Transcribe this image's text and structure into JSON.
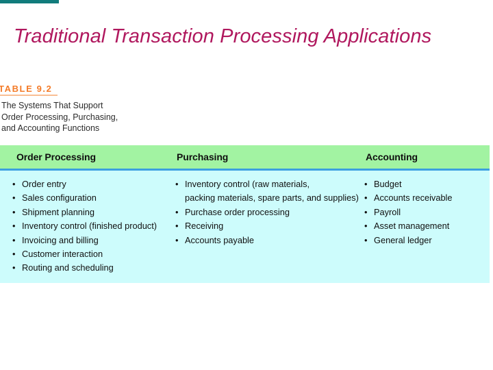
{
  "slide": {
    "title": "Traditional Transaction Processing Applications",
    "title_color": "#B0185E",
    "accent_bar_color": "#117C7C",
    "background": "#ffffff"
  },
  "table": {
    "number_label": "TABLE 9.2",
    "number_color": "#F47B28",
    "caption_lines": [
      "The Systems That Support",
      "Order Processing, Purchasing,",
      "and Accounting Functions"
    ],
    "header_background": "#A2F3A2",
    "header_rule_color": "#3C9FE0",
    "body_background": "#CDFCFC",
    "bullet_glyph": "•",
    "columns": [
      {
        "header": "Order Processing",
        "items": [
          {
            "line1": "Order entry"
          },
          {
            "line1": "Sales configuration"
          },
          {
            "line1": "Shipment planning"
          },
          {
            "line1": "Inventory control (finished product)"
          },
          {
            "line1": "Invoicing and billing"
          },
          {
            "line1": "Customer interaction"
          },
          {
            "line1": "Routing and scheduling"
          }
        ]
      },
      {
        "header": "Purchasing",
        "items": [
          {
            "line1": "Inventory control (raw materials,",
            "line2": "packing materials, spare parts, and supplies)"
          },
          {
            "line1": "Purchase order processing"
          },
          {
            "line1": "Receiving"
          },
          {
            "line1": "Accounts payable"
          }
        ]
      },
      {
        "header": "Accounting",
        "items": [
          {
            "line1": "Budget"
          },
          {
            "line1": "Accounts receivable"
          },
          {
            "line1": "Payroll"
          },
          {
            "line1": "Asset management"
          },
          {
            "line1": "General ledger"
          }
        ]
      }
    ]
  }
}
